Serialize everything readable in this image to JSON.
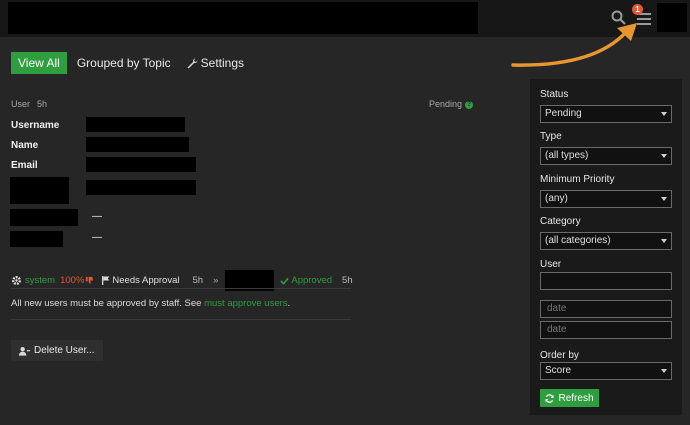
{
  "nav": {
    "view_all": "View All",
    "grouped_by_topic": "Grouped by Topic",
    "settings": "Settings"
  },
  "header": {
    "notification_count": "1"
  },
  "review": {
    "type_label": "User",
    "age": "5h",
    "status": "Pending",
    "fields": {
      "username": "Username",
      "name": "Name",
      "email": "Email"
    },
    "extra_values": [
      "—",
      "—"
    ],
    "history": {
      "actor": "system",
      "score": "100%",
      "needs_approval": "Needs Approval",
      "needs_age": "5h",
      "arrow": "»",
      "approved": "Approved",
      "approved_age": "5h"
    },
    "note_prefix": "All new users must be approved by staff. See ",
    "note_link": "must approve users",
    "note_suffix": ".",
    "delete_button": "Delete User..."
  },
  "filters": {
    "status_label": "Status",
    "status_value": "Pending",
    "type_label": "Type",
    "type_value": "(all types)",
    "priority_label": "Minimum Priority",
    "priority_value": "(any)",
    "category_label": "Category",
    "category_value": "(all categories)",
    "user_label": "User",
    "user_value": "",
    "date_from_placeholder": "date",
    "date_to_placeholder": "date",
    "order_label": "Order by",
    "order_value": "Score",
    "refresh_button": "Refresh"
  },
  "colors": {
    "accent_green": "#2e9e3f",
    "danger_red": "#e45735",
    "annotation_arrow": "#e8962e"
  },
  "icons": [
    "search-icon",
    "hamburger-menu-icon",
    "wrench-icon",
    "help-icon",
    "gear-icon",
    "thumbs-down-icon",
    "flag-icon",
    "check-icon",
    "user-remove-icon",
    "refresh-icon"
  ]
}
